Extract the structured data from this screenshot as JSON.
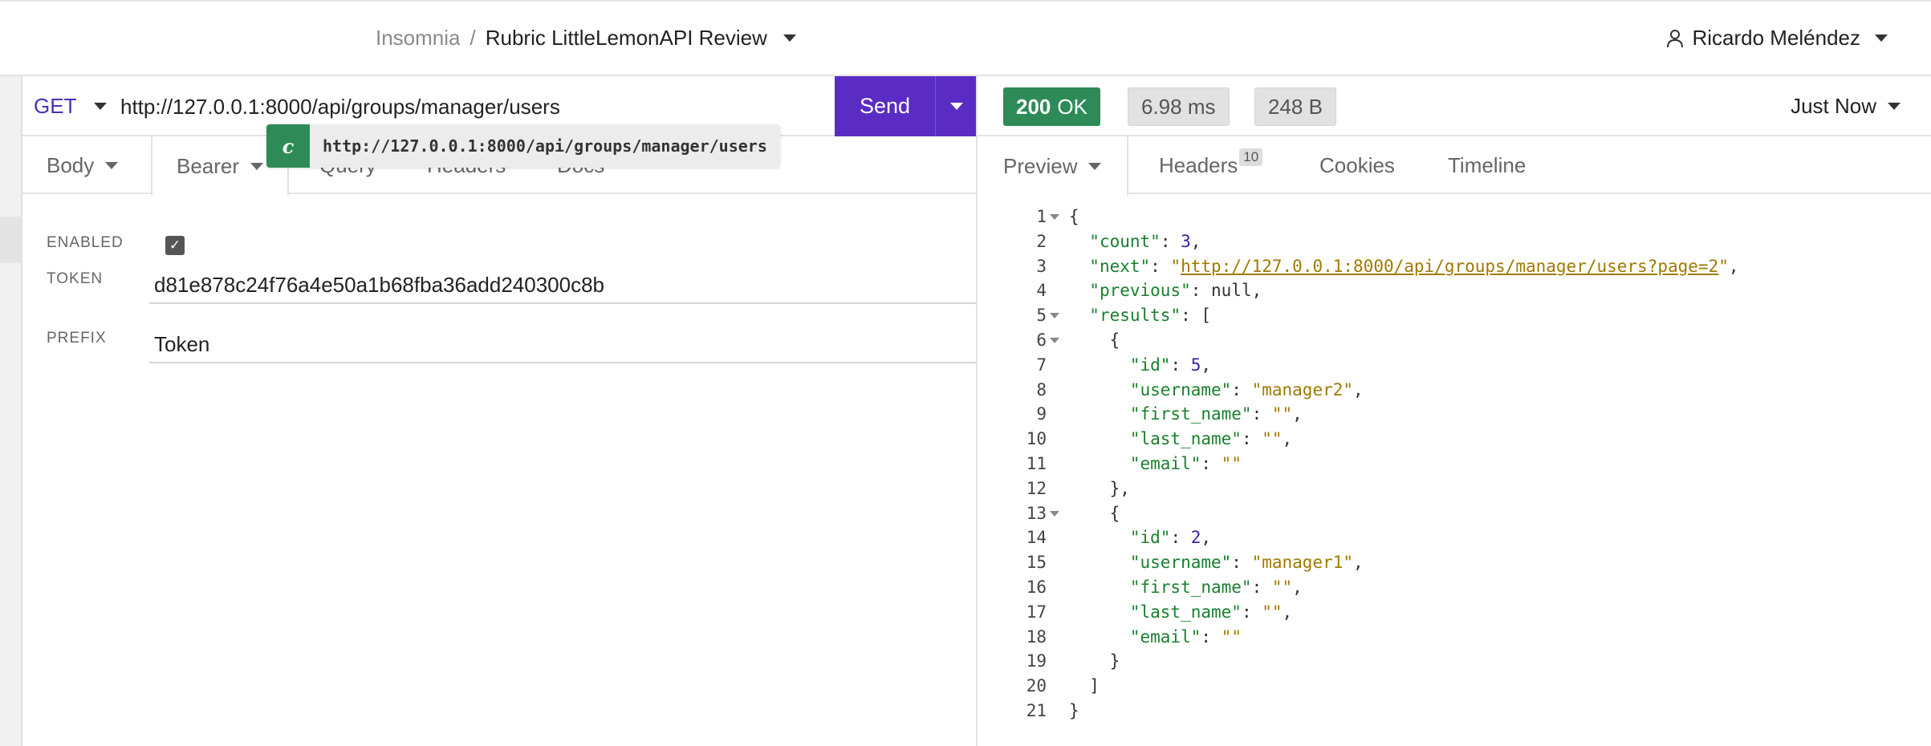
{
  "header": {
    "app_name": "Insomnia",
    "separator": "/",
    "workspace": "Rubric LittleLemonAPI Review",
    "user_name": "Ricardo Meléndez"
  },
  "request": {
    "method": "GET",
    "url": "http://127.0.0.1:8000/api/groups/manager/users",
    "send_label": "Send",
    "tabs": [
      {
        "label": "Body"
      },
      {
        "label": "Bearer"
      },
      {
        "label": "Query"
      },
      {
        "label": "Headers"
      },
      {
        "label": "Docs"
      }
    ],
    "tooltip": {
      "badge": "c",
      "text": "http://127.0.0.1:8000/api/groups/manager/users"
    },
    "auth": {
      "enabled_label": "ENABLED",
      "enabled": true,
      "token_label": "TOKEN",
      "token_value": "d81e878c24f76a4e50a1b68fba36add240300c8b",
      "prefix_label": "PREFIX",
      "prefix_value": "Token"
    }
  },
  "response": {
    "status_code": "200",
    "status_text": "OK",
    "time": "6.98 ms",
    "size": "248 B",
    "timestamp": "Just Now",
    "tabs": [
      {
        "label": "Preview"
      },
      {
        "label": "Headers",
        "count": "10"
      },
      {
        "label": "Cookies"
      },
      {
        "label": "Timeline"
      }
    ],
    "body_lines": [
      "{",
      "  \"count\": 3,",
      "  \"next\": \"http://127.0.0.1:8000/api/groups/manager/users?page=2\",",
      "  \"previous\": null,",
      "  \"results\": [",
      "    {",
      "      \"id\": 5,",
      "      \"username\": \"manager2\",",
      "      \"first_name\": \"\",",
      "      \"last_name\": \"\",",
      "      \"email\": \"\"",
      "    },",
      "    {",
      "      \"id\": 2,",
      "      \"username\": \"manager1\",",
      "      \"first_name\": \"\",",
      "      \"last_name\": \"\",",
      "      \"email\": \"\"",
      "    }",
      "  ]",
      "}"
    ],
    "foldable_lines": [
      1,
      5,
      6,
      13
    ]
  },
  "colors": {
    "accent": "#5a2cc4",
    "success": "#2e8b57",
    "json_key": "#1a7f2e",
    "json_string": "#a07a00",
    "json_number": "#3d21a8"
  }
}
